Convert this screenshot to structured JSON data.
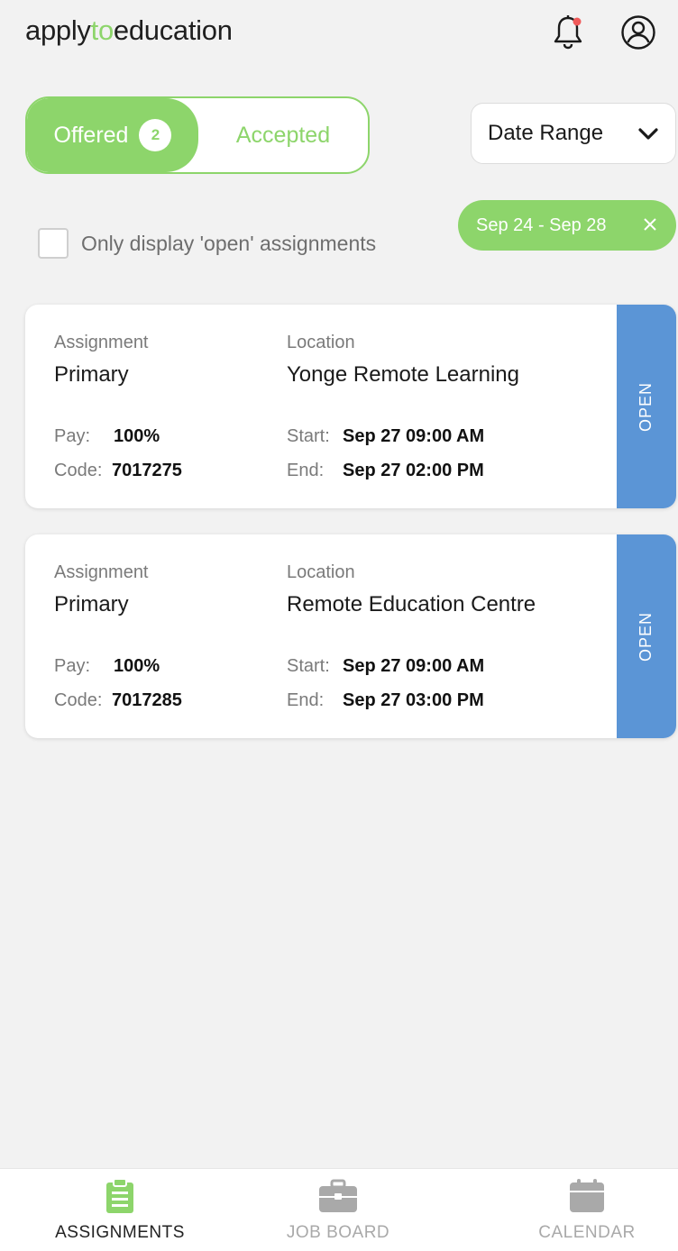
{
  "header": {
    "logo_part1": "apply",
    "logo_part2": "to",
    "logo_part3": "education",
    "bell_icon": "bell-icon",
    "profile_icon": "user-circle-icon"
  },
  "tabs": {
    "offered_label": "Offered",
    "offered_count": "2",
    "accepted_label": "Accepted"
  },
  "filter": {
    "date_range_label": "Date Range",
    "chip_label": "Sep 24 - Sep 28",
    "chip_close": "✕",
    "open_only_label": "Only display 'open' assignments",
    "open_only_checked": false
  },
  "cards": [
    {
      "assignment_label": "Assignment",
      "assignment": "Primary",
      "location_label": "Location",
      "location": "Yonge Remote Learning",
      "pay_label": "Pay:",
      "pay": "100%",
      "code_label": "Code:",
      "code": "7017275",
      "start_label": "Start:",
      "start": "Sep 27 09:00 AM",
      "end_label": "End:",
      "end": "Sep 27 02:00 PM",
      "status": "OPEN"
    },
    {
      "assignment_label": "Assignment",
      "assignment": "Primary",
      "location_label": "Location",
      "location": "Remote Education Centre",
      "pay_label": "Pay:",
      "pay": "100%",
      "code_label": "Code:",
      "code": "7017285",
      "start_label": "Start:",
      "start": "Sep 27 09:00 AM",
      "end_label": "End:",
      "end": "Sep 27 03:00 PM",
      "status": "OPEN"
    }
  ],
  "bottom_nav": {
    "items": [
      {
        "label": "ASSIGNMENTS",
        "icon": "clipboard-icon",
        "active": true
      },
      {
        "label": "JOB BOARD",
        "icon": "briefcase-icon",
        "active": false
      },
      {
        "label": "CALENDAR",
        "icon": "calendar-icon",
        "active": false
      }
    ]
  },
  "colors": {
    "accent_green": "#8dd56b",
    "status_blue": "#5b95d6",
    "background": "#f2f2f2",
    "inactive_gray": "#a9a9a9"
  }
}
